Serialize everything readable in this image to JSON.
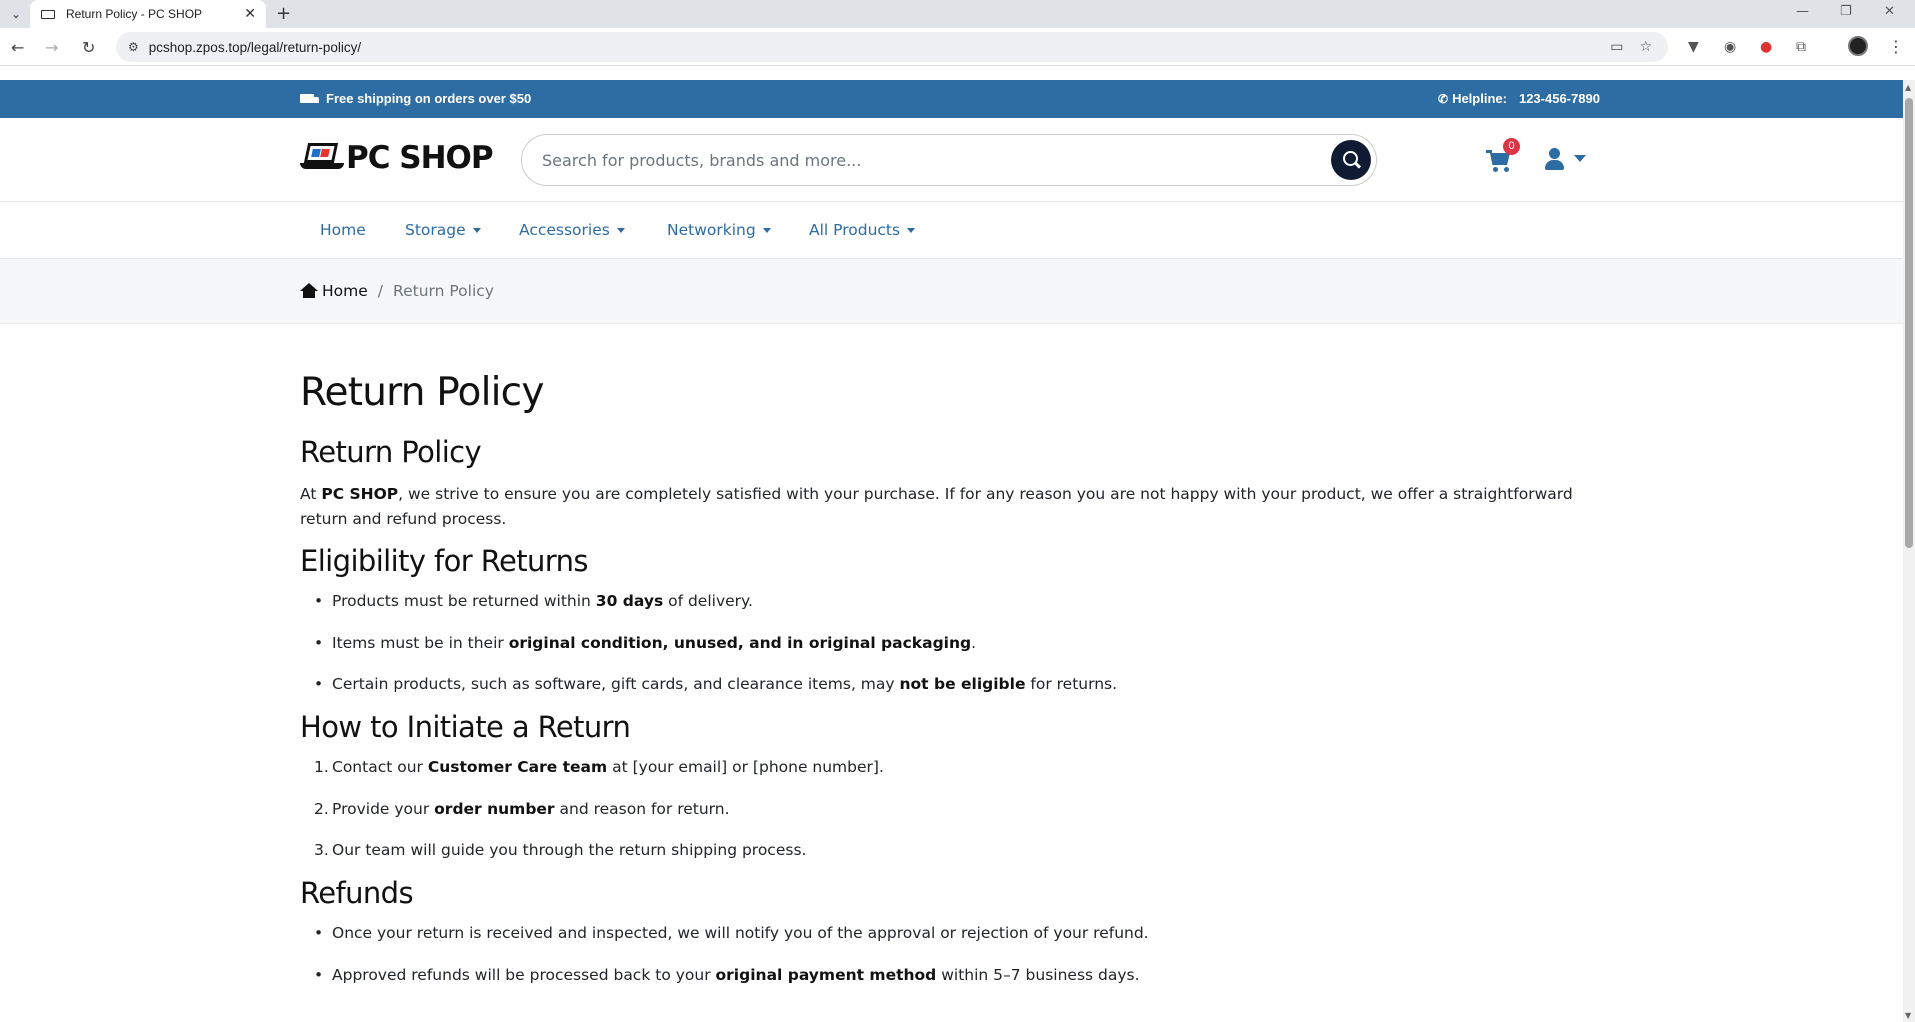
{
  "browser": {
    "tab_title": "Return Policy - PC SHOP",
    "url": "pcshop.zpos.top/legal/return-policy/",
    "new_tab": "+",
    "tab_close": "✕"
  },
  "topbar": {
    "shipping_text": "Free shipping on orders over $50",
    "helpline_label": "Helpline:",
    "helpline_number": "123-456-7890"
  },
  "header": {
    "brand": "PC SHOP",
    "search_placeholder": "Search for products, brands and more...",
    "cart_count": "0"
  },
  "nav": {
    "items": [
      {
        "label": "Home",
        "has_dropdown": false
      },
      {
        "label": "Storage",
        "has_dropdown": true
      },
      {
        "label": "Accessories",
        "has_dropdown": true
      },
      {
        "label": "Networking",
        "has_dropdown": true
      },
      {
        "label": "All Products",
        "has_dropdown": true
      }
    ]
  },
  "breadcrumb": {
    "home": "Home",
    "separator": "/",
    "current": "Return Policy"
  },
  "article": {
    "page_title": "Return Policy",
    "section1_title": "Return Policy",
    "intro_prefix": "At ",
    "intro_brand": "PC SHOP",
    "intro_rest": ", we strive to ensure you are completely satisfied with your purchase. If for any reason you are not happy with your product, we offer a straightforward return and refund process.",
    "eligibility_title": "Eligibility for Returns",
    "eligibility": [
      {
        "pre": "Products must be returned within ",
        "bold": "30 days",
        "post": " of delivery."
      },
      {
        "pre": "Items must be in their ",
        "bold": "original condition, unused, and in original packaging",
        "post": "."
      },
      {
        "pre": "Certain products, such as software, gift cards, and clearance items, may ",
        "bold": "not be eligible",
        "post": " for returns."
      }
    ],
    "initiate_title": "How to Initiate a Return",
    "initiate": [
      {
        "num": "1.",
        "pre": "Contact our ",
        "bold": "Customer Care team",
        "post": " at [your email] or [phone number]."
      },
      {
        "num": "2.",
        "pre": "Provide your ",
        "bold": "order number",
        "post": " and reason for return."
      },
      {
        "num": "3.",
        "pre": "Our team will guide you through the return shipping process.",
        "bold": "",
        "post": ""
      }
    ],
    "refunds_title": "Refunds",
    "refunds": [
      {
        "pre": "Once your return is received and inspected, we will notify you of the approval or rejection of your refund.",
        "bold": "",
        "post": ""
      },
      {
        "pre": "Approved refunds will be processed back to your ",
        "bold": "original payment method",
        "post": " within 5–7 business days."
      }
    ]
  },
  "colors": {
    "brand_blue": "#2e6da4",
    "search_button": "#0e1b33",
    "badge_red": "#dc3545"
  }
}
